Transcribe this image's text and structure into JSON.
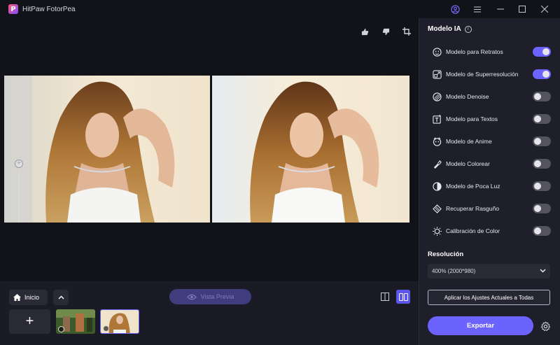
{
  "app": {
    "title": "HitPaw FotorPea",
    "logo_letter": "P"
  },
  "right_panel": {
    "title": "Modelo IA",
    "models": [
      {
        "label": "Modelo para Retratos",
        "icon": "portrait-icon",
        "enabled": true
      },
      {
        "label": "Modelo de Superresolución",
        "icon": "upscale-icon",
        "enabled": true
      },
      {
        "label": "Modelo Denoise",
        "icon": "denoise-icon",
        "enabled": false
      },
      {
        "label": "Modelo para Textos",
        "icon": "text-icon",
        "enabled": false
      },
      {
        "label": "Modelo de Anime",
        "icon": "anime-icon",
        "enabled": false
      },
      {
        "label": "Modelo Colorear",
        "icon": "colorize-icon",
        "enabled": false
      },
      {
        "label": "Modelo de Poca Luz",
        "icon": "low-light-icon",
        "enabled": false
      },
      {
        "label": "Recuperar Rasguño",
        "icon": "scratch-icon",
        "enabled": false
      },
      {
        "label": "Calibración de Color",
        "icon": "color-calibration-icon",
        "enabled": false
      }
    ],
    "resolution_label": "Resolución",
    "resolution_value": "400% (2000*980)",
    "apply_all_label": "Aplicar los Ajustes Actuales a Todas",
    "export_label": "Exportar"
  },
  "bottom": {
    "home_label": "Inicio",
    "preview_label": "Vista Previa",
    "add_symbol": "+"
  },
  "colors": {
    "accent": "#6c63ff",
    "panel": "#1f1f2b",
    "background": "#121219"
  }
}
